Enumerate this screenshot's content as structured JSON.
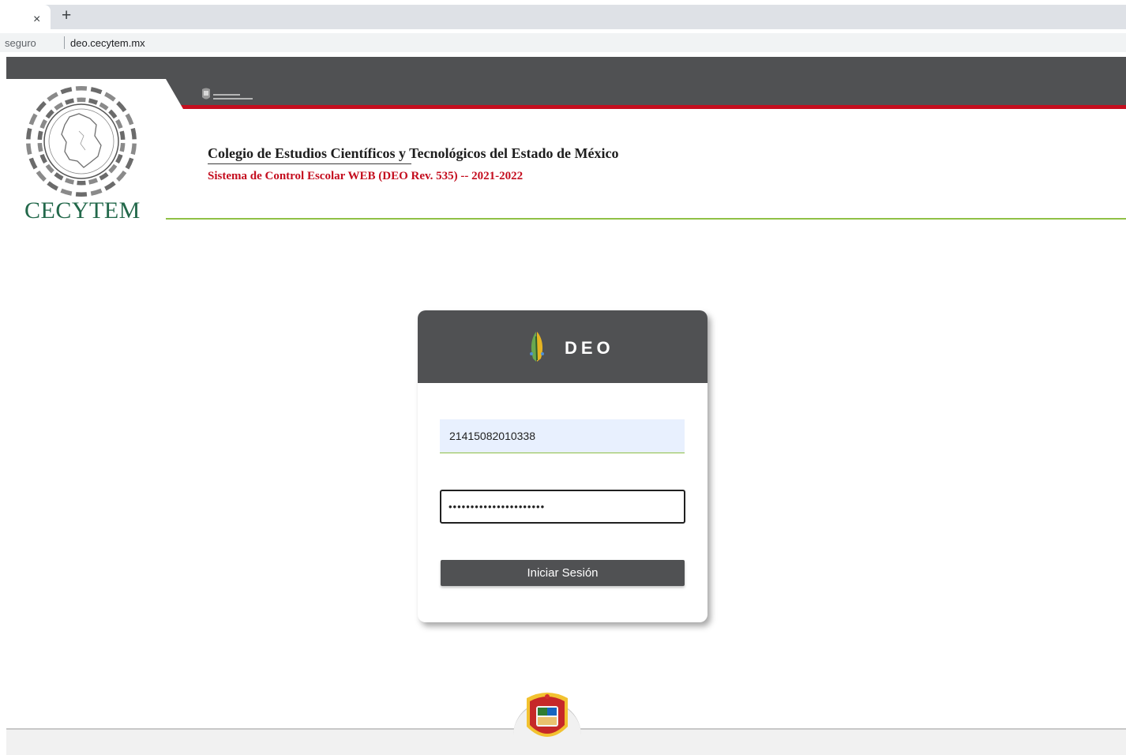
{
  "browser": {
    "tab_close": "×",
    "new_tab": "+",
    "security_label": "seguro",
    "url": "deo.cecytem.mx"
  },
  "header": {
    "logo_text": "CECYTEM",
    "logo_ring_text": "COLEGIO DE ESTUDIOS CIENTÍFICOS Y TECNOLÓGICOS DEL ESTADO DE MÉXICO",
    "title": "Colegio de Estudios Científicos y Tecnológicos del Estado de México",
    "subtitle": "Sistema de Control Escolar WEB (DEO Rev. 535) -- 2021-2022",
    "colors": {
      "dark_bar": "#505153",
      "red_accent": "#c40d1e",
      "green_accent": "#8fc045",
      "logo_green": "#22684a"
    }
  },
  "login": {
    "card_title": "DEO",
    "card_icon": "deo-leaf-icon",
    "username_value": "21415082010338",
    "password_value": "••••••••••••••••••••••",
    "submit_label": "Iniciar Sesión"
  },
  "footer": {
    "seal_icon": "estado-de-mexico-seal-icon"
  }
}
